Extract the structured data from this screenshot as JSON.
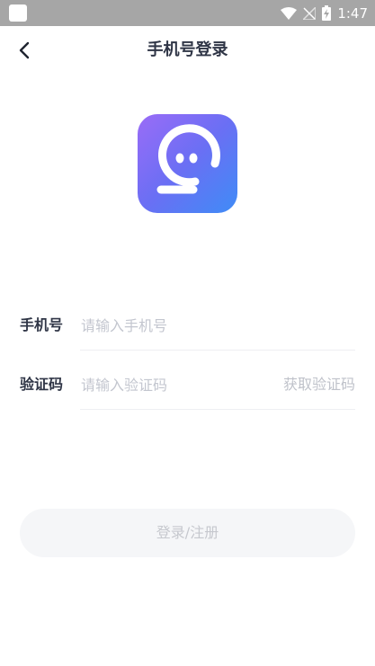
{
  "status_bar": {
    "time": "1:47",
    "icons": [
      "wifi-icon",
      "signal-off-icon",
      "battery-charging-icon"
    ]
  },
  "header": {
    "title": "手机号登录",
    "back_icon": "chevron-left-icon"
  },
  "logo": {
    "icon": "chat-bubble-logo",
    "colors": {
      "start": "#9a6cf7",
      "end": "#3f8cf6"
    }
  },
  "form": {
    "phone": {
      "label": "手机号",
      "placeholder": "请输入手机号",
      "value": ""
    },
    "code": {
      "label": "验证码",
      "placeholder": "请输入验证码",
      "value": "",
      "get_code_label": "获取验证码"
    }
  },
  "submit": {
    "label": "登录/注册"
  },
  "colors": {
    "title": "#2f3546",
    "placeholder": "#c3c6cf",
    "button_bg": "#f5f6f8",
    "button_text": "#c6c8ce",
    "status_bar": "#a6a6a6"
  }
}
